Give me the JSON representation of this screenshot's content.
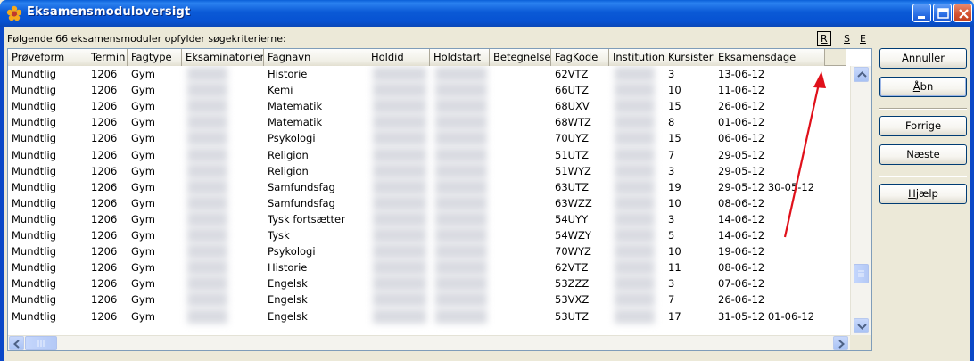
{
  "window": {
    "title": "Eksamensmoduloversigt",
    "icons": {
      "app": "flower-icon",
      "minimize": "minimize-icon",
      "maximize": "maximize-icon",
      "close": "close-icon"
    }
  },
  "caption": "Følgende 66 eksamensmoduler opfylder søgekriterierne:",
  "sort_links": {
    "r": "R",
    "s": "S",
    "e": "E"
  },
  "table": {
    "columns": [
      "Prøveform",
      "Termin",
      "Fagtype",
      "Eksaminator(er)",
      "Fagnavn",
      "Holdid",
      "Holdstart",
      "Betegnelse",
      "FagKode",
      "Institution",
      "Kursister",
      "Eksamensdage"
    ],
    "rows": [
      [
        "Mundtlig",
        "1206",
        "Gym",
        "",
        "Historie",
        "",
        "",
        "",
        "62VTZ",
        "",
        "3",
        "13-06-12"
      ],
      [
        "Mundtlig",
        "1206",
        "Gym",
        "",
        "Kemi",
        "",
        "",
        "",
        "66UTZ",
        "",
        "10",
        "11-06-12"
      ],
      [
        "Mundtlig",
        "1206",
        "Gym",
        "",
        "Matematik",
        "",
        "",
        "",
        "68UXV",
        "",
        "15",
        "26-06-12"
      ],
      [
        "Mundtlig",
        "1206",
        "Gym",
        "",
        "Matematik",
        "",
        "",
        "",
        "68WTZ",
        "",
        "8",
        "01-06-12"
      ],
      [
        "Mundtlig",
        "1206",
        "Gym",
        "",
        "Psykologi",
        "",
        "",
        "",
        "70UYZ",
        "",
        "15",
        "06-06-12"
      ],
      [
        "Mundtlig",
        "1206",
        "Gym",
        "",
        "Religion",
        "",
        "",
        "",
        "51UTZ",
        "",
        "7",
        "29-05-12"
      ],
      [
        "Mundtlig",
        "1206",
        "Gym",
        "",
        "Religion",
        "",
        "",
        "",
        "51WYZ",
        "",
        "3",
        "29-05-12"
      ],
      [
        "Mundtlig",
        "1206",
        "Gym",
        "",
        "Samfundsfag",
        "",
        "",
        "",
        "63UTZ",
        "",
        "19",
        "29-05-12 30-05-12"
      ],
      [
        "Mundtlig",
        "1206",
        "Gym",
        "",
        "Samfundsfag",
        "",
        "",
        "",
        "63WZZ",
        "",
        "10",
        "08-06-12"
      ],
      [
        "Mundtlig",
        "1206",
        "Gym",
        "",
        "Tysk fortsætter",
        "",
        "",
        "",
        "54UYY",
        "",
        "3",
        "14-06-12"
      ],
      [
        "Mundtlig",
        "1206",
        "Gym",
        "",
        "Tysk",
        "",
        "",
        "",
        "54WZY",
        "",
        "5",
        "14-06-12"
      ],
      [
        "Mundtlig",
        "1206",
        "Gym",
        "",
        "Psykologi",
        "",
        "",
        "",
        "70WYZ",
        "",
        "10",
        "19-06-12"
      ],
      [
        "Mundtlig",
        "1206",
        "Gym",
        "",
        "Historie",
        "",
        "",
        "",
        "62VTZ",
        "",
        "11",
        "08-06-12"
      ],
      [
        "Mundtlig",
        "1206",
        "Gym",
        "",
        "Engelsk",
        "",
        "",
        "",
        "53ZZZ",
        "",
        "3",
        "07-06-12"
      ],
      [
        "Mundtlig",
        "1206",
        "Gym",
        "",
        "Engelsk",
        "",
        "",
        "",
        "53VXZ",
        "",
        "7",
        "26-06-12"
      ],
      [
        "Mundtlig",
        "1206",
        "Gym",
        "",
        "Engelsk",
        "",
        "",
        "",
        "53UTZ",
        "",
        "17",
        "31-05-12 01-06-12"
      ]
    ]
  },
  "buttons": {
    "annuller": "Annuller",
    "abn_first": "Å",
    "abn_rest": "bn",
    "forrige": "Forrige",
    "naeste": "Næste",
    "hjaelp_first": "H",
    "hjaelp_rest": "jælp"
  },
  "colors": {
    "titlebar": "#0752d2",
    "annotation": "#e0101a",
    "grid_border": "#7f9db9"
  }
}
